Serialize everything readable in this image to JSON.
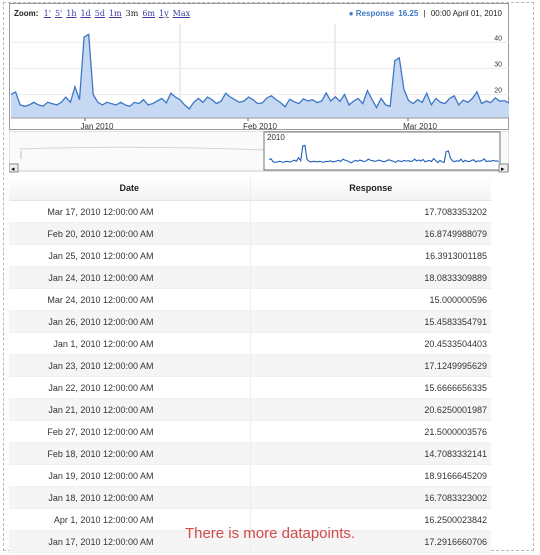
{
  "zoom": {
    "label": "Zoom:",
    "options": [
      {
        "label": "1'",
        "active": false
      },
      {
        "label": "5'",
        "active": false
      },
      {
        "label": "1h",
        "active": false
      },
      {
        "label": "1d",
        "active": false
      },
      {
        "label": "5d",
        "active": false
      },
      {
        "label": "1m",
        "active": false
      },
      {
        "label": "3m",
        "active": true
      },
      {
        "label": "6m",
        "active": false
      },
      {
        "label": "1y",
        "active": false
      },
      {
        "label": "Max",
        "active": false
      }
    ]
  },
  "legend": {
    "series_name": "Response",
    "series_value": "16.25",
    "separator": "|",
    "timestamp": "00:00 April 01, 2010"
  },
  "chart_data": {
    "type": "area",
    "y_ticks": [
      "40",
      "30",
      "20"
    ],
    "x_labels": [
      "Jan 2010",
      "Feb 2010",
      "Mar 2010"
    ],
    "series": [
      {
        "name": "Response",
        "values": [
          20,
          21,
          16,
          15.5,
          16,
          17,
          16,
          15.5,
          17,
          16.5,
          16,
          17,
          19,
          17,
          23,
          18,
          42,
          43,
          20,
          17,
          16,
          17,
          16.5,
          16,
          17,
          16,
          15.5,
          17,
          16.5,
          18,
          16,
          16.5,
          17.5,
          18.5,
          16.8,
          20.5,
          19,
          18,
          16,
          14.5,
          17,
          18.5,
          17,
          19,
          18,
          16.5,
          17.5,
          20.5,
          19,
          18,
          17,
          17.5,
          19,
          18,
          16.5,
          16.8,
          18.7,
          19.5,
          18.1,
          16.9,
          15.3,
          18.2,
          17.2,
          16.5,
          18.3,
          17.5,
          18,
          16.9,
          17.5,
          20.6,
          17.5,
          19.1,
          17.3,
          20,
          16,
          17.5,
          18.5,
          16.5,
          21.5,
          18.2,
          15,
          18.5,
          16,
          15.5,
          33,
          34,
          22,
          17.7,
          16.5,
          18,
          17,
          20.5,
          16,
          18.5,
          17,
          16.5,
          18.5,
          19.5,
          16,
          17.8,
          17,
          18.5,
          21,
          16.5,
          17.5,
          16.9,
          18.7,
          17.4,
          17.7,
          16.7
        ]
      }
    ],
    "grid": true,
    "range_selector": {
      "label": "2010"
    }
  },
  "table": {
    "columns": [
      "Date",
      "Response"
    ],
    "rows": [
      [
        "Mar 17, 2010 12:00:00 AM",
        "17.7083353202"
      ],
      [
        "Feb 20, 2010 12:00:00 AM",
        "16.8749988079"
      ],
      [
        "Jan 25, 2010 12:00:00 AM",
        "16.3913001185"
      ],
      [
        "Jan 24, 2010 12:00:00 AM",
        "18.0833309889"
      ],
      [
        "Mar 24, 2010 12:00:00 AM",
        "15.000000596"
      ],
      [
        "Jan 26, 2010 12:00:00 AM",
        "15.4583354791"
      ],
      [
        "Jan 1, 2010 12:00:00 AM",
        "20.4533504403"
      ],
      [
        "Jan 23, 2010 12:00:00 AM",
        "17.1249995629"
      ],
      [
        "Jan 22, 2010 12:00:00 AM",
        "15.6666656335"
      ],
      [
        "Jan 21, 2010 12:00:00 AM",
        "20.6250001987"
      ],
      [
        "Feb 27, 2010 12:00:00 AM",
        "21.5000003576"
      ],
      [
        "Feb 18, 2010 12:00:00 AM",
        "14.7083332141"
      ],
      [
        "Jan 19, 2010 12:00:00 AM",
        "18.9166645209"
      ],
      [
        "Jan 18, 2010 12:00:00 AM",
        "16.7083323002"
      ],
      [
        "Apr 1, 2010 12:00:00 AM",
        "16.2500023842"
      ],
      [
        "Jan 17, 2010 12:00:00 AM",
        "17.2916660706"
      ]
    ]
  },
  "footer": {
    "message": "There is more datapoints."
  }
}
